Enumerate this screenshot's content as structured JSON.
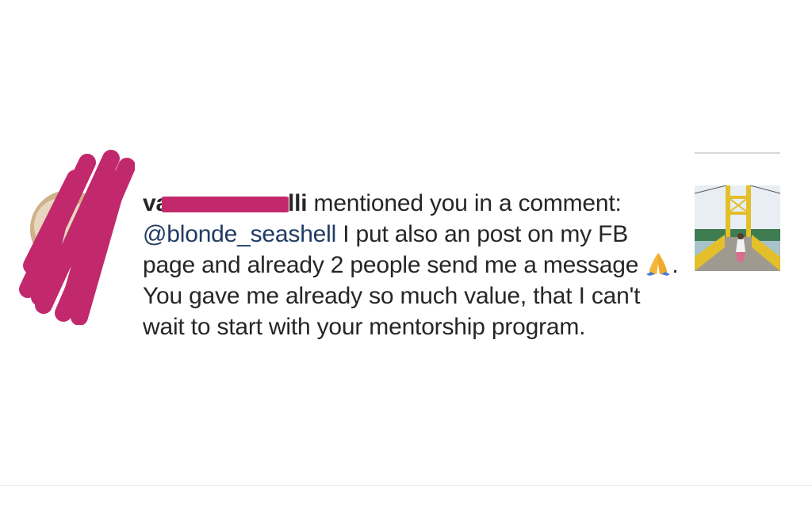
{
  "notification": {
    "username_visible": "va",
    "username_end": "lli",
    "action_text": "mentioned you in a comment:",
    "mention_handle": "@blonde_seashell",
    "comment_text_1": " I put also an post on my FB page and already  2 people send me a message ",
    "emoji_name": "folded-hands-emoji",
    "comment_text_2": ". You gave me already so much value, that I can't wait to start with your mentorship program.",
    "redaction_color": "#c2286c"
  },
  "thumbnail": {
    "description_icon": "bridge-photo-thumbnail"
  }
}
